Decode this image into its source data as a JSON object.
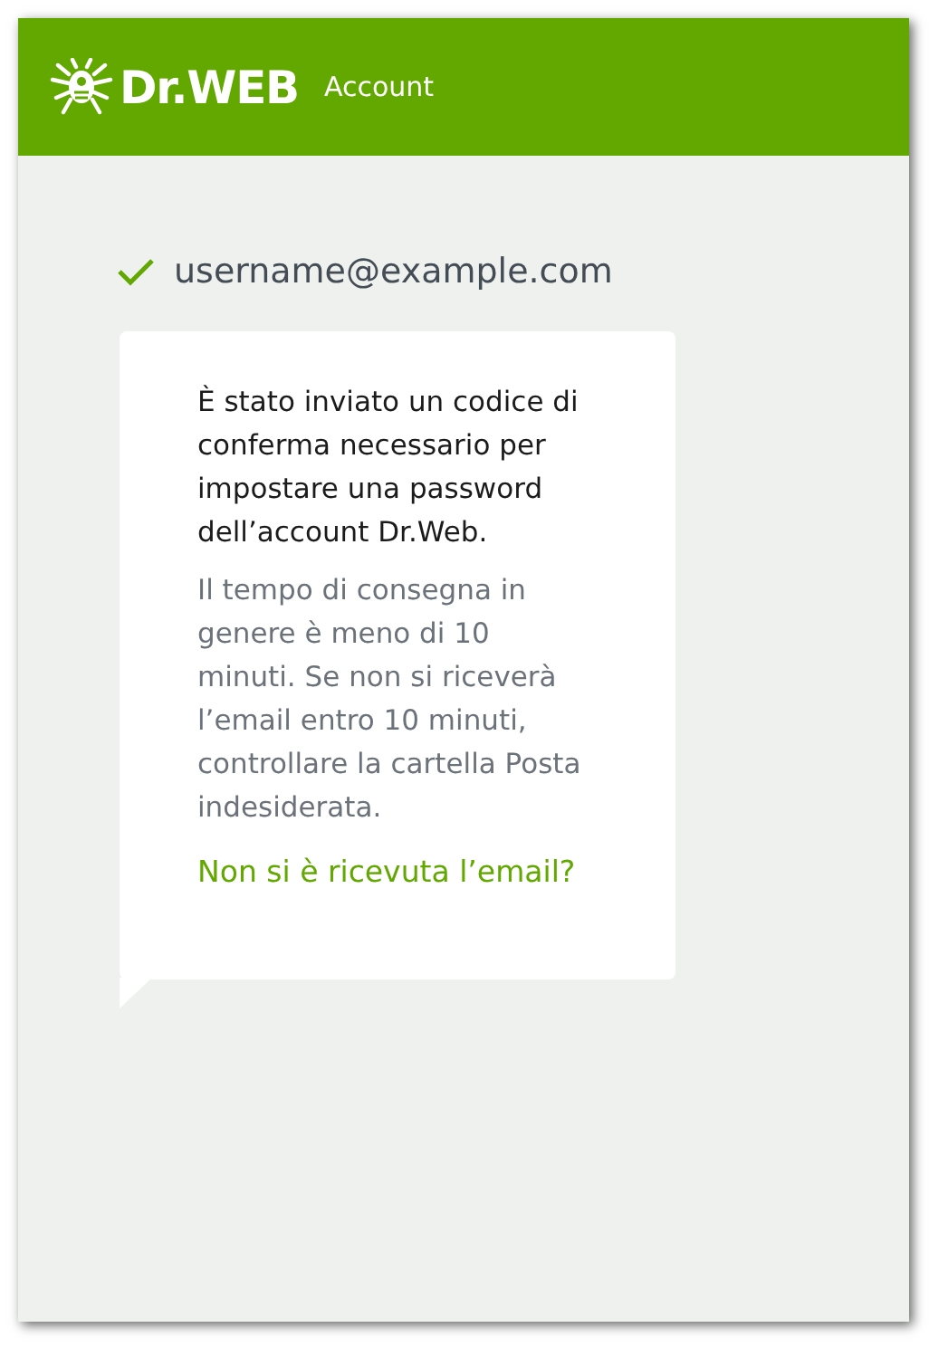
{
  "header": {
    "logo": "Dr.WEB",
    "title": "Account"
  },
  "account": {
    "email": "username@example.com",
    "verified": true
  },
  "message": {
    "main": "È stato inviato un codice di conferma necessario per impostare una password dell’account Dr.Web.",
    "note": "Il tempo di consegna in genere è meno di 10 minuti. Se non si riceverà l’email entro 10 minuti, controllare la cartella Posta indesiderata.",
    "link": "Non si è ricevuta l’email?"
  }
}
